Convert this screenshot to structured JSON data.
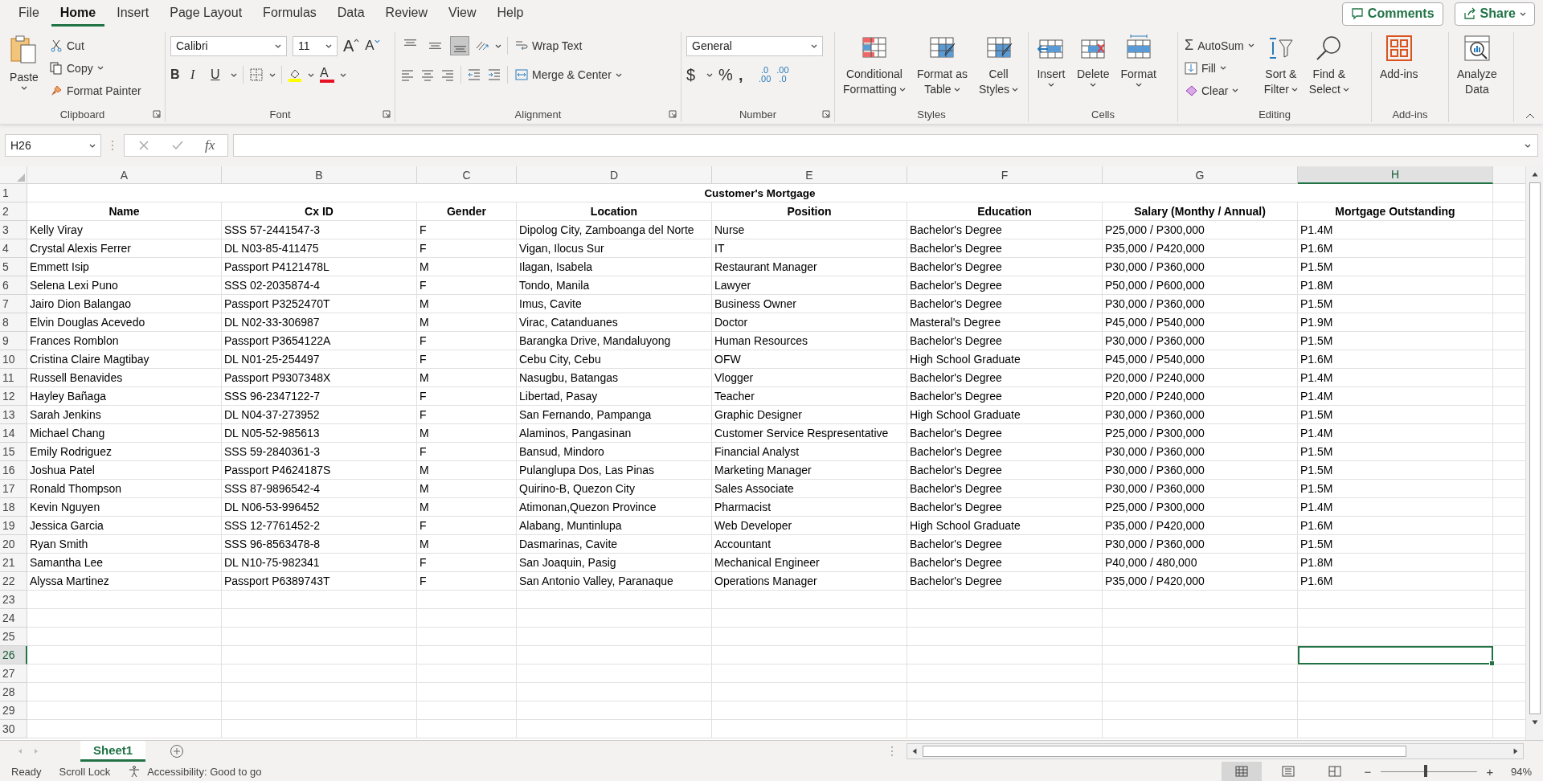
{
  "menu_tabs": [
    {
      "label": "File",
      "selected": false
    },
    {
      "label": "Home",
      "selected": true
    },
    {
      "label": "Insert",
      "selected": false
    },
    {
      "label": "Page Layout",
      "selected": false
    },
    {
      "label": "Formulas",
      "selected": false
    },
    {
      "label": "Data",
      "selected": false
    },
    {
      "label": "Review",
      "selected": false
    },
    {
      "label": "View",
      "selected": false
    },
    {
      "label": "Help",
      "selected": false
    }
  ],
  "header_buttons": {
    "comments": "Comments",
    "share": "Share"
  },
  "ribbon": {
    "clipboard": {
      "label": "Clipboard",
      "paste": "Paste",
      "cut": "Cut",
      "copy": "Copy",
      "format_painter": "Format Painter"
    },
    "font": {
      "label": "Font",
      "family": "Calibri",
      "size": "11",
      "grow": "A",
      "shrink": "A",
      "bold": "B",
      "italic": "I",
      "underline": "U",
      "font_color": "A"
    },
    "alignment": {
      "label": "Alignment",
      "vertical": [
        {
          "selected": false
        },
        {
          "selected": false
        },
        {
          "selected": true
        }
      ],
      "wrap_text": "Wrap Text",
      "merge_center": "Merge & Center"
    },
    "number": {
      "label": "Number",
      "format": "General",
      "symbols": [
        "$",
        "%",
        ","
      ],
      "decimals": [
        [
          ".0",
          ".00"
        ],
        [
          ".00",
          ".0"
        ]
      ]
    },
    "styles": {
      "label": "Styles",
      "buttons": [
        [
          "Conditional",
          "Formatting"
        ],
        [
          "Format as",
          "Table"
        ],
        [
          "Cell",
          "Styles"
        ]
      ]
    },
    "cells": {
      "label": "Cells",
      "buttons": [
        "Insert",
        "Delete",
        "Format"
      ]
    },
    "editing": {
      "label": "Editing",
      "sigma": "Σ",
      "autosum": "AutoSum",
      "fill": "Fill",
      "clear": "Clear",
      "sort": [
        "Sort &",
        "Filter"
      ],
      "find": [
        "Find &",
        "Select"
      ]
    },
    "addins": {
      "label": "Add-ins",
      "button": "Add-ins"
    },
    "analyze": {
      "button": [
        "Analyze",
        "Data"
      ]
    }
  },
  "formula_bar": {
    "name_box": "H26",
    "fx": "fx"
  },
  "sheet": {
    "columns": [
      {
        "letter": "A",
        "selected": false
      },
      {
        "letter": "B",
        "selected": false
      },
      {
        "letter": "C",
        "selected": false
      },
      {
        "letter": "D",
        "selected": false
      },
      {
        "letter": "E",
        "selected": false
      },
      {
        "letter": "F",
        "selected": false
      },
      {
        "letter": "G",
        "selected": false
      },
      {
        "letter": "H",
        "selected": true
      }
    ],
    "rows": [
      {
        "number": "1",
        "selected": false,
        "kind": "title",
        "title": "Customer's Mortgage"
      },
      {
        "number": "2",
        "selected": false,
        "kind": "header",
        "cells": [
          "Name",
          "Cx ID",
          "Gender",
          "Location",
          "Position",
          "Education",
          "Salary (Monthy / Annual)",
          "Mortgage Outstanding"
        ]
      },
      {
        "number": "3",
        "selected": false,
        "kind": "data",
        "cells": [
          "Kelly Viray",
          "SSS 57-2441547-3",
          "F",
          "Dipolog City, Zamboanga del Norte",
          "Nurse",
          "Bachelor's Degree",
          "P25,000 / P300,000",
          "P1.4M"
        ]
      },
      {
        "number": "4",
        "selected": false,
        "kind": "data",
        "cells": [
          "Crystal Alexis Ferrer",
          "DL N03-85-411475",
          "F",
          "Vigan, Ilocus Sur",
          "IT",
          "Bachelor's Degree",
          "P35,000 / P420,000",
          "P1.6M"
        ]
      },
      {
        "number": "5",
        "selected": false,
        "kind": "data",
        "cells": [
          "Emmett Isip",
          "Passport P4121478L",
          "M",
          "Ilagan, Isabela",
          "Restaurant Manager",
          "Bachelor's Degree",
          "P30,000 / P360,000",
          "P1.5M"
        ]
      },
      {
        "number": "6",
        "selected": false,
        "kind": "data",
        "cells": [
          "Selena Lexi Puno",
          "SSS 02-2035874-4",
          "F",
          "Tondo, Manila",
          "Lawyer",
          "Bachelor's Degree",
          "P50,000 / P600,000",
          "P1.8M"
        ]
      },
      {
        "number": "7",
        "selected": false,
        "kind": "data",
        "cells": [
          "Jairo Dion Balangao",
          "Passport P3252470T",
          "M",
          "Imus, Cavite",
          "Business Owner",
          "Bachelor's Degree",
          "P30,000 / P360,000",
          "P1.5M"
        ]
      },
      {
        "number": "8",
        "selected": false,
        "kind": "data",
        "cells": [
          "Elvin Douglas Acevedo",
          "DL N02-33-306987",
          "M",
          "Virac, Catanduanes",
          "Doctor",
          "Masteral's Degree",
          "P45,000 / P540,000",
          "P1.9M"
        ]
      },
      {
        "number": "9",
        "selected": false,
        "kind": "data",
        "cells": [
          "Frances Romblon",
          "Passport P3654122A",
          "F",
          "Barangka Drive, Mandaluyong",
          "Human Resources",
          "Bachelor's Degree",
          "P30,000 / P360,000",
          "P1.5M"
        ]
      },
      {
        "number": "10",
        "selected": false,
        "kind": "data",
        "cells": [
          "Cristina Claire Magtibay",
          "DL N01-25-254497",
          "F",
          "Cebu City, Cebu",
          "OFW",
          "High School Graduate",
          "P45,000 / P540,000",
          "P1.6M"
        ]
      },
      {
        "number": "11",
        "selected": false,
        "kind": "data",
        "cells": [
          "Russell Benavides",
          "Passport P9307348X",
          "M",
          "Nasugbu, Batangas",
          "Vlogger",
          "Bachelor's Degree",
          "P20,000 / P240,000",
          "P1.4M"
        ]
      },
      {
        "number": "12",
        "selected": false,
        "kind": "data",
        "cells": [
          "Hayley Bañaga",
          "SSS 96-2347122-7",
          "F",
          "Libertad, Pasay",
          "Teacher",
          "Bachelor's Degree",
          "P20,000 / P240,000",
          "P1.4M"
        ]
      },
      {
        "number": "13",
        "selected": false,
        "kind": "data",
        "cells": [
          "Sarah Jenkins",
          "DL N04-37-273952",
          "F",
          "San Fernando, Pampanga",
          "Graphic Designer",
          "High School Graduate",
          "P30,000 / P360,000",
          "P1.5M"
        ]
      },
      {
        "number": "14",
        "selected": false,
        "kind": "data",
        "cells": [
          "Michael Chang",
          "DL N05-52-985613",
          "M",
          "Alaminos, Pangasinan",
          "Customer Service Respresentative",
          "Bachelor's Degree",
          "P25,000 / P300,000",
          "P1.4M"
        ]
      },
      {
        "number": "15",
        "selected": false,
        "kind": "data",
        "cells": [
          "Emily Rodriguez",
          "SSS 59-2840361-3",
          "F",
          "Bansud, Mindoro",
          "Financial Analyst",
          "Bachelor's Degree",
          "P30,000 / P360,000",
          "P1.5M"
        ]
      },
      {
        "number": "16",
        "selected": false,
        "kind": "data",
        "cells": [
          "Joshua Patel",
          "Passport P4624187S",
          "M",
          "Pulanglupa Dos, Las Pinas",
          "Marketing Manager",
          "Bachelor's Degree",
          "P30,000 / P360,000",
          "P1.5M"
        ]
      },
      {
        "number": "17",
        "selected": false,
        "kind": "data",
        "cells": [
          "Ronald Thompson",
          "SSS 87-9896542-4",
          "M",
          "Quirino-B, Quezon City",
          "Sales Associate",
          "Bachelor's Degree",
          "P30,000 / P360,000",
          "P1.5M"
        ]
      },
      {
        "number": "18",
        "selected": false,
        "kind": "data",
        "cells": [
          "Kevin Nguyen",
          "DL N06-53-996452",
          "M",
          "Atimonan,Quezon Province",
          "Pharmacist",
          "Bachelor's Degree",
          "P25,000 / P300,000",
          "P1.4M"
        ]
      },
      {
        "number": "19",
        "selected": false,
        "kind": "data",
        "cells": [
          "Jessica Garcia",
          "SSS 12-7761452-2",
          "F",
          "Alabang, Muntinlupa",
          "Web Developer",
          "High School Graduate",
          "P35,000 / P420,000",
          "P1.6M"
        ]
      },
      {
        "number": "20",
        "selected": false,
        "kind": "data",
        "cells": [
          "Ryan Smith",
          "SSS 96-8563478-8",
          "M",
          "Dasmarinas, Cavite",
          "Accountant",
          "Bachelor's Degree",
          "P30,000 / P360,000",
          "P1.5M"
        ]
      },
      {
        "number": "21",
        "selected": false,
        "kind": "data",
        "cells": [
          "Samantha Lee",
          "DL N10-75-982341",
          "F",
          "San Joaquin, Pasig",
          "Mechanical Engineer",
          "Bachelor's Degree",
          "P40,000 / 480,000",
          "P1.8M"
        ]
      },
      {
        "number": "22",
        "selected": false,
        "kind": "data",
        "cells": [
          "Alyssa Martinez",
          "Passport P6389743T",
          "F",
          "San Antonio Valley, Paranaque",
          "Operations Manager",
          "Bachelor's Degree",
          "P35,000 / P420,000",
          "P1.6M"
        ]
      },
      {
        "number": "23",
        "selected": false,
        "kind": "empty"
      },
      {
        "number": "24",
        "selected": false,
        "kind": "empty"
      },
      {
        "number": "25",
        "selected": false,
        "kind": "empty"
      },
      {
        "number": "26",
        "selected": true,
        "kind": "empty"
      },
      {
        "number": "27",
        "selected": false,
        "kind": "empty"
      },
      {
        "number": "28",
        "selected": false,
        "kind": "empty"
      },
      {
        "number": "29",
        "selected": false,
        "kind": "empty"
      },
      {
        "number": "30",
        "selected": false,
        "kind": "empty"
      }
    ]
  },
  "sheet_tabs": [
    {
      "label": "Sheet1",
      "selected": true
    }
  ],
  "status_bar": {
    "ready": "Ready",
    "scroll_lock": "Scroll Lock",
    "accessibility": "Accessibility: Good to go",
    "views": [
      {
        "selected": true
      },
      {
        "selected": false
      },
      {
        "selected": false
      }
    ],
    "zoom_out": "−",
    "zoom_in": "+",
    "zoom": {
      "level": 0.47
    },
    "zoom_text": "94%"
  }
}
